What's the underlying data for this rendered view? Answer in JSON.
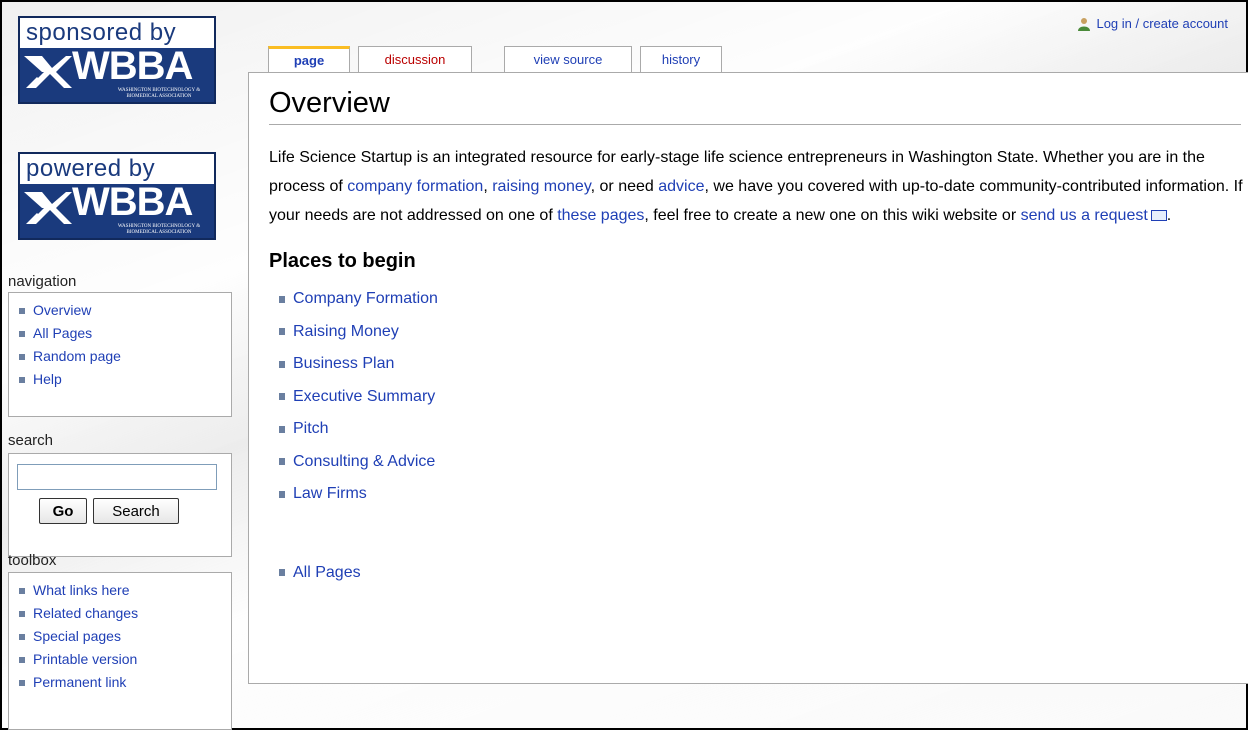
{
  "personal": {
    "login_label": "Log in / create account"
  },
  "logos": {
    "sponsored_top": "sponsored by",
    "powered_top": "powered by",
    "mark_text": "WBBA",
    "subtitle": "WASHINGTON BIOTECHNOLOGY & BIOMEDICAL ASSOCIATION"
  },
  "tabs": [
    {
      "label": "page"
    },
    {
      "label": "discussion"
    },
    {
      "label": "view source"
    },
    {
      "label": "history"
    }
  ],
  "navigation": {
    "title": "navigation",
    "items": [
      {
        "label": "Overview"
      },
      {
        "label": "All Pages"
      },
      {
        "label": "Random page"
      },
      {
        "label": "Help"
      }
    ]
  },
  "search": {
    "title": "search",
    "value": "",
    "go_label": "Go",
    "search_label": "Search"
  },
  "toolbox": {
    "title": "toolbox",
    "items": [
      {
        "label": "What links here"
      },
      {
        "label": "Related changes"
      },
      {
        "label": "Special pages"
      },
      {
        "label": "Printable version"
      },
      {
        "label": "Permanent link"
      }
    ]
  },
  "content": {
    "title": "Overview",
    "intro": {
      "t1": "Life Science Startup is an integrated resource for early-stage life science entrepreneurs in Washington State. Whether you are in the process of ",
      "link1": "company formation",
      "t2": ", ",
      "link2": "raising money",
      "t3": ", or need ",
      "link3": "advice",
      "t4": ", we have you covered with up-to-date community-contributed information. If your needs are not addressed on one of ",
      "link4": "these pages",
      "t5": ", feel free to create a new one on this wiki website or ",
      "link5": "send us a request",
      "t6": "."
    },
    "places_heading": "Places to begin",
    "places": [
      {
        "label": "Company Formation"
      },
      {
        "label": "Raising Money"
      },
      {
        "label": "Business Plan"
      },
      {
        "label": "Executive Summary"
      },
      {
        "label": "Pitch"
      },
      {
        "label": "Consulting & Advice"
      },
      {
        "label": "Law Firms"
      }
    ],
    "all_pages_label": "All Pages"
  },
  "colors": {
    "link": "#1f3fb5",
    "new_link": "#ba0000",
    "logo_blue": "#1a3a7d",
    "selected_tab_accent": "#fabd23"
  }
}
